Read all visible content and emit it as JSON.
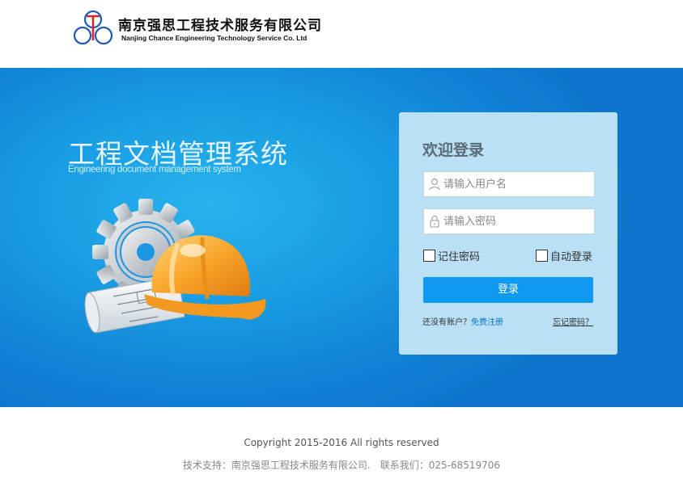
{
  "header": {
    "company_cn": "南京强思工程技术服务有限公司",
    "company_en": "Nanjing Chance Engineering Technology Service Co. Ltd",
    "logo_icon": "company-logo-rings"
  },
  "banner": {
    "system_title": "工程文档管理系统",
    "system_subtitle": "Engineering document management system",
    "illustration": "gear-helmet-blueprint"
  },
  "login": {
    "welcome": "欢迎登录",
    "username_placeholder": "请输入用户名",
    "password_placeholder": "请输入密码",
    "remember_label": "记住密码",
    "auto_login_label": "自动登录",
    "submit_label": "登录",
    "no_account_text": "还没有账户？",
    "register_link": "免费注册",
    "forgot_link": "忘记密码？"
  },
  "footer": {
    "copyright": "Copyright 2015-2016 All rights reserved",
    "support": "技术支持：南京强思工程技术服务有限公司.",
    "contact": "联系我们：025-68519706"
  },
  "colors": {
    "banner_blue": "#1aa0e4",
    "panel_bg": "#b9e0f4",
    "button_blue": "#0d9af0",
    "link_blue": "#0a73c9"
  }
}
